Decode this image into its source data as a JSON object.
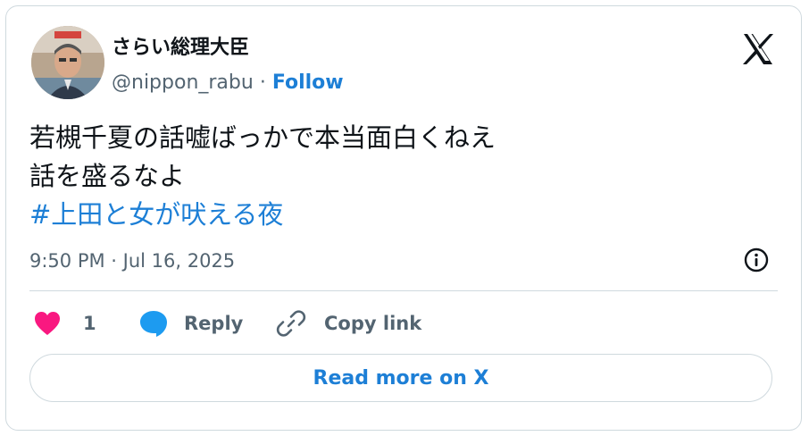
{
  "user": {
    "display_name": "さらい総理大臣",
    "handle": "@nippon_rabu",
    "separator": " · ",
    "follow_label": "Follow"
  },
  "tweet": {
    "line1": "若槻千夏の話嘘ばっかで本当面白くねえ",
    "line2": "話を盛るなよ",
    "hashtag": "#上田と女が吠える夜",
    "timestamp": "9:50 PM · Jul 16, 2025"
  },
  "actions": {
    "like_count": "1",
    "reply_label": "Reply",
    "copy_link_label": "Copy link"
  },
  "read_more_label": "Read more on X",
  "colors": {
    "accent": "#1d7fd6",
    "like": "#f91880",
    "text": "#0f1419",
    "muted": "#536471",
    "border": "#cfd9de"
  },
  "icons": [
    "x-logo-icon",
    "info-icon",
    "heart-icon",
    "reply-bubble-icon",
    "link-icon"
  ]
}
